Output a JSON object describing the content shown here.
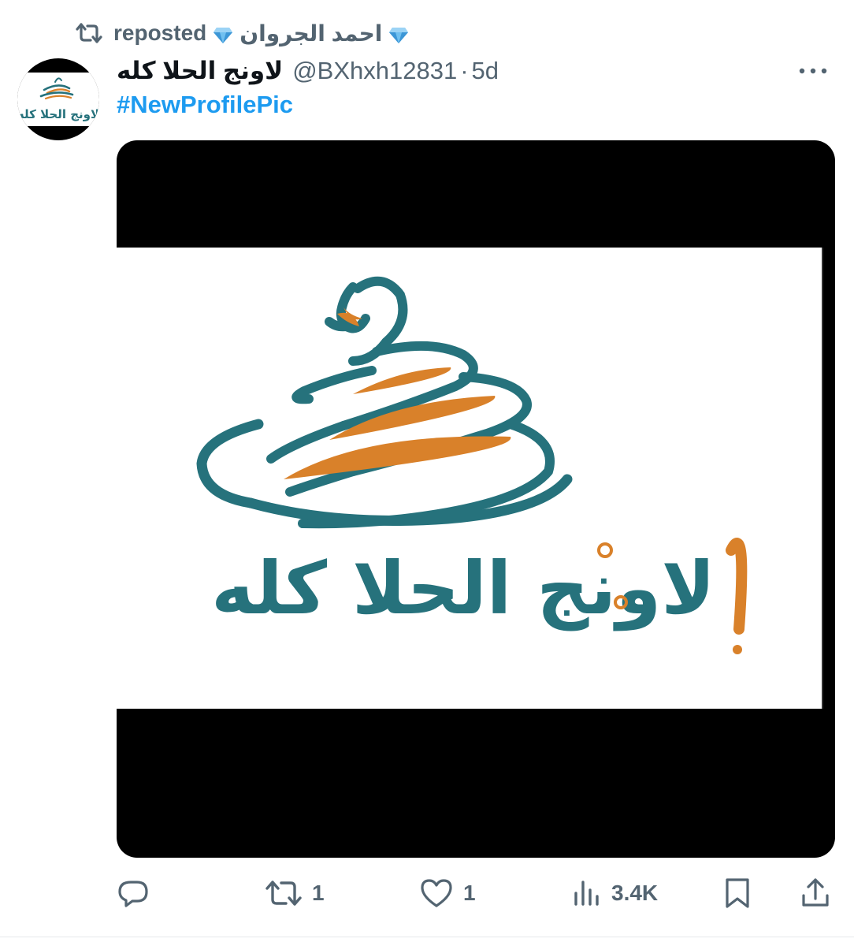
{
  "repost": {
    "icon": "repost-icon",
    "label": "reposted",
    "user_name": "احمد الجروان"
  },
  "tweet": {
    "author": {
      "display_name": "لاونج الحلا كله",
      "handle": "@BXhxh12831",
      "separator": "·",
      "time": "5d",
      "avatar_logo_text": "لاونج الحلا كله"
    },
    "hashtag": "#NewProfilePic",
    "media": {
      "logo_text": "لاونج الحلا كله",
      "colors": {
        "teal": "#26727c",
        "orange": "#d9812a"
      }
    },
    "actions": {
      "reply": {
        "icon": "reply-icon",
        "count": ""
      },
      "repost": {
        "icon": "repost-icon",
        "count": "1"
      },
      "like": {
        "icon": "heart-icon",
        "count": "1"
      },
      "views": {
        "icon": "analytics-icon",
        "count": "3.4K"
      },
      "bookmark": {
        "icon": "bookmark-icon"
      },
      "share": {
        "icon": "share-icon"
      }
    }
  },
  "colors": {
    "text_primary": "#0f1419",
    "text_secondary": "#536471",
    "link": "#1d9bf0",
    "diamond": "#4aa3df"
  }
}
